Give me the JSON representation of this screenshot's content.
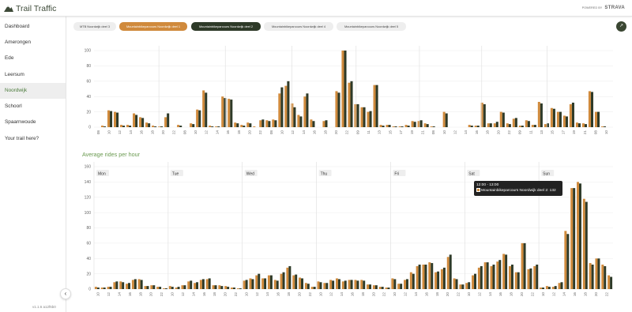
{
  "app": {
    "title": "Trail Traffic",
    "powered_by": "POWERED BY",
    "brand": "STRAVA",
    "version": "v1.1.6 a12f6b0"
  },
  "sidebar": {
    "items": [
      {
        "label": "Dashboard",
        "active": false
      },
      {
        "label": "Amerongen",
        "active": false
      },
      {
        "label": "Ede",
        "active": false
      },
      {
        "label": "Leersum",
        "active": false
      },
      {
        "label": "Noordwijk",
        "active": true
      },
      {
        "label": "Schoorl",
        "active": false
      },
      {
        "label": "Spaarnwoude",
        "active": false
      },
      {
        "label": "Your trail here?",
        "active": false
      }
    ],
    "collapse_icon": "chevron-left-icon"
  },
  "tabs": [
    {
      "label": "MTB Noordwijk deel 3",
      "state": "default"
    },
    {
      "label": "Mountainbikeparcours Noordwijk deel 1",
      "state": "selected-orange"
    },
    {
      "label": "Mountainbikeparcours Noordwijk deel 2",
      "state": "selected-dark"
    },
    {
      "label": "Mountainbikeparcours Noordwijk deel 4",
      "state": "default"
    },
    {
      "label": "Mountainbikeparcours Noordwijk deel 5",
      "state": "default"
    }
  ],
  "share_icon": "share-icon",
  "colors": {
    "orange": "#d08a3c",
    "dark": "#2e3a28",
    "accent_green": "#6a9a50"
  },
  "avg_title": "Average rides per hour",
  "tooltip": {
    "time": "12:00 - 13:00",
    "label": "Mountainbikeparcours Noordwijk deel 2: 132"
  },
  "chart_data": [
    {
      "type": "bar",
      "title": "",
      "ylim": [
        0,
        100
      ],
      "yticks": [
        0,
        20,
        40,
        60,
        80,
        100
      ],
      "x_tick_labels": [
        "08",
        "10",
        "12",
        "14",
        "16",
        "18",
        "20",
        "22",
        "08",
        "10",
        "12",
        "14",
        "16",
        "18",
        "20",
        "22",
        "08",
        "10",
        "12",
        "14",
        "16",
        "18",
        "20",
        "22",
        "09",
        "11",
        "13",
        "15",
        "17",
        "19",
        "21",
        "08",
        "10",
        "12",
        "14",
        "16",
        "18",
        "20",
        "22",
        "09",
        "11",
        "13",
        "15",
        "17",
        "19",
        "21",
        "08",
        "10"
      ],
      "series": [
        {
          "name": "Mountainbikeparcours Noordwijk deel 1",
          "color": "#d08a3c",
          "values": [
            0,
            2,
            22,
            20,
            3,
            3,
            18,
            13,
            6,
            2,
            1,
            13,
            0,
            3,
            0,
            5,
            23,
            48,
            2,
            1,
            40,
            37,
            6,
            3,
            6,
            1,
            9,
            9,
            10,
            44,
            54,
            31,
            16,
            40,
            10,
            0,
            8,
            0,
            47,
            100,
            58,
            30,
            26,
            20,
            55,
            3,
            3,
            1,
            1,
            3,
            8,
            8,
            5,
            1,
            0,
            20,
            0,
            0,
            0,
            3,
            2,
            32,
            5,
            5,
            20,
            5,
            11,
            2,
            9,
            3,
            33,
            4,
            25,
            20,
            15,
            30,
            6,
            5,
            47,
            20,
            1,
            0
          ],
          "total_slots": 82
        },
        {
          "name": "Mountainbikeparcours Noordwijk deel 2",
          "color": "#2e3a28",
          "values": [
            0,
            1,
            21,
            19,
            2,
            2,
            16,
            12,
            5,
            1,
            1,
            18,
            0,
            2,
            0,
            4,
            22,
            45,
            1,
            1,
            38,
            36,
            5,
            2,
            5,
            0,
            10,
            8,
            9,
            52,
            60,
            26,
            14,
            44,
            8,
            0,
            9,
            0,
            45,
            100,
            60,
            30,
            26,
            21,
            55,
            2,
            3,
            1,
            1,
            2,
            7,
            9,
            4,
            1,
            0,
            18,
            0,
            0,
            0,
            2,
            2,
            30,
            5,
            7,
            19,
            4,
            12,
            2,
            8,
            3,
            31,
            5,
            24,
            20,
            14,
            32,
            5,
            4,
            46,
            20,
            1,
            0
          ],
          "total_slots": 82
        }
      ]
    },
    {
      "type": "bar",
      "title": "Average rides per hour",
      "ylim": [
        0,
        160
      ],
      "yticks": [
        0,
        20,
        40,
        60,
        80,
        100,
        120,
        140,
        160
      ],
      "days": [
        "Mon",
        "Tue",
        "Wed",
        "Thu",
        "Fri",
        "Sat",
        "Sun"
      ],
      "x_tick_labels": [
        "10",
        "12",
        "14",
        "16",
        "18",
        "20",
        "22",
        "10",
        "12",
        "14",
        "16",
        "18",
        "20",
        "22",
        "10",
        "12",
        "14",
        "16",
        "18",
        "20",
        "22",
        "10",
        "12",
        "14",
        "16",
        "18",
        "20",
        "22",
        "10",
        "12",
        "14",
        "16",
        "18",
        "20",
        "22",
        "10",
        "12",
        "14",
        "16",
        "18",
        "20",
        "22",
        "10",
        "12",
        "14",
        "16",
        "18",
        "20",
        "22"
      ],
      "series": [
        {
          "name": "Mountainbikeparcours Noordwijk deel 1",
          "color": "#d08a3c",
          "values": [
            3,
            2,
            3,
            9,
            10,
            7,
            12,
            13,
            4,
            5,
            3,
            1,
            4,
            2,
            5,
            10,
            8,
            12,
            13,
            5,
            5,
            4,
            2,
            1,
            11,
            14,
            18,
            14,
            18,
            12,
            20,
            28,
            18,
            15,
            8,
            3,
            10,
            8,
            12,
            14,
            10,
            12,
            12,
            12,
            6,
            5,
            3,
            2,
            14,
            7,
            12,
            22,
            30,
            32,
            35,
            22,
            26,
            42,
            14,
            6,
            8,
            18,
            28,
            35,
            30,
            36,
            46,
            30,
            22,
            60,
            26,
            30,
            2,
            4,
            3,
            8,
            76,
            132,
            140,
            118,
            34,
            40,
            32,
            18
          ]
        },
        {
          "name": "Mountainbikeparcours Noordwijk deel 2",
          "color": "#2e3a28",
          "values": [
            2,
            2,
            3,
            10,
            9,
            8,
            13,
            12,
            4,
            5,
            3,
            1,
            3,
            3,
            5,
            11,
            9,
            13,
            14,
            5,
            4,
            3,
            2,
            1,
            12,
            13,
            20,
            14,
            18,
            11,
            22,
            30,
            19,
            14,
            7,
            3,
            9,
            8,
            11,
            13,
            11,
            12,
            11,
            11,
            6,
            5,
            3,
            2,
            13,
            7,
            13,
            20,
            32,
            32,
            34,
            23,
            28,
            45,
            13,
            6,
            9,
            20,
            30,
            35,
            32,
            38,
            45,
            32,
            22,
            60,
            27,
            32,
            2,
            3,
            4,
            9,
            72,
            132,
            138,
            114,
            32,
            40,
            30,
            16
          ]
        }
      ]
    }
  ]
}
